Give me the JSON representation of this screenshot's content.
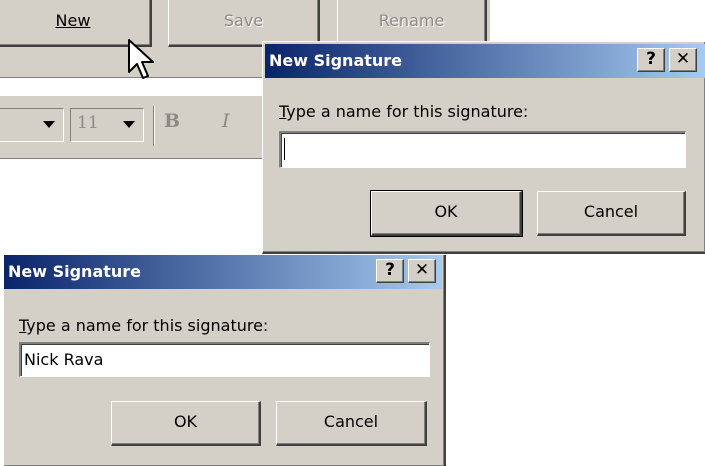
{
  "toolbar": {
    "new_label": "New",
    "save_label": "Save",
    "rename_label": "Rename",
    "font_size_value": "11",
    "bold_glyph": "B",
    "italic_glyph": "I"
  },
  "dialog_front": {
    "title": "New Signature",
    "help_glyph": "?",
    "close_glyph": "✕",
    "prompt_mnemonic": "T",
    "prompt_rest": "ype a name for this signature:",
    "input_value": "",
    "ok_label": "OK",
    "cancel_label": "Cancel"
  },
  "dialog_back": {
    "title": "New Signature",
    "help_glyph": "?",
    "close_glyph": "✕",
    "prompt_mnemonic": "T",
    "prompt_rest": "ype a name for this signature:",
    "input_value": "Nick Rava",
    "ok_label": "OK",
    "cancel_label": "Cancel"
  },
  "icons": {
    "cursor": "arrow-cursor-icon",
    "font_dropdown": "chevron-down-icon",
    "size_dropdown": "chevron-down-icon"
  },
  "colors": {
    "titlebar_start": "#0a246a",
    "titlebar_end": "#a6caf0",
    "face": "#d4d0c8",
    "disabled_text": "#8c8a84"
  }
}
